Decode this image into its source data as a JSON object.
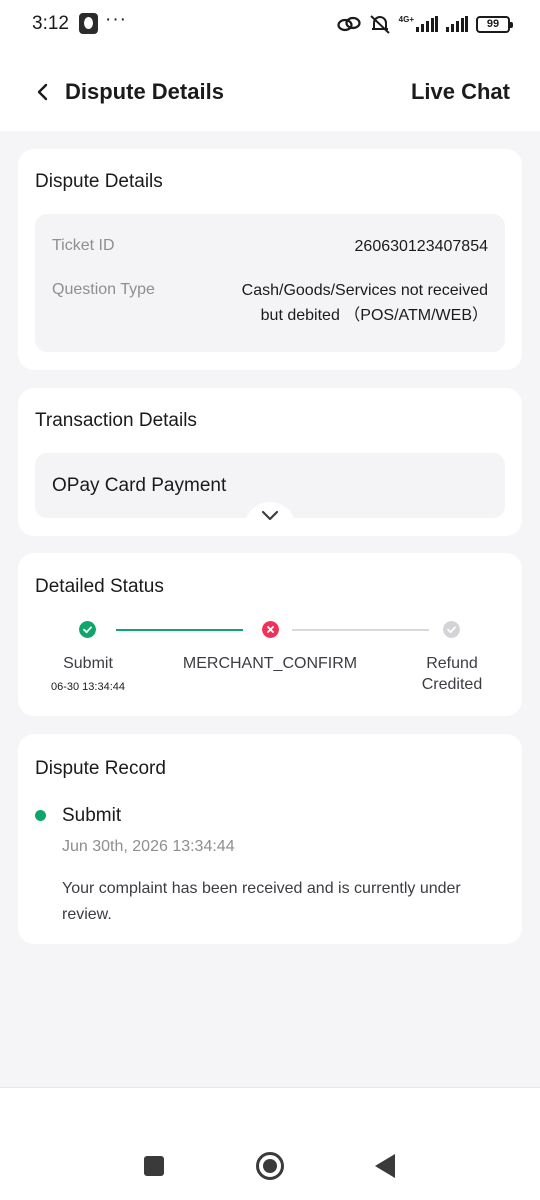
{
  "status_bar": {
    "time": "3:12",
    "dots": "···",
    "network_label": "4G+",
    "battery": "99"
  },
  "header": {
    "title": "Dispute Details",
    "live_chat_label": "Live Chat"
  },
  "dispute_details": {
    "title": "Dispute Details",
    "ticket_id_label": "Ticket ID",
    "ticket_id_value": "260630123407854",
    "question_type_label": "Question Type",
    "question_type_line1": "Cash/Goods/Services not received",
    "question_type_line2": "but debited （POS/ATM/WEB）"
  },
  "transaction_details": {
    "title": "Transaction Details",
    "payment_label": "OPay Card Payment"
  },
  "detailed_status": {
    "title": "Detailed Status",
    "steps": [
      {
        "label": "Submit",
        "time": "06-30 13:34:44",
        "state": "done"
      },
      {
        "label": "MERCHANT_CONFIRM",
        "time": "",
        "state": "failed"
      },
      {
        "label_line1": "Refund",
        "label_line2": "Credited",
        "state": "pending"
      }
    ]
  },
  "dispute_record": {
    "title": "Dispute Record",
    "entries": [
      {
        "title": "Submit",
        "time": "Jun 30th, 2026 13:34:44",
        "description": "Your complaint has been received and is currently under review."
      }
    ]
  },
  "colors": {
    "accent_green": "#0fa66c",
    "error_red": "#f0325a",
    "pending_gray": "#d4d4d8",
    "background": "#f5f5f7"
  },
  "icons": {
    "back": "chevron-left-icon",
    "expand": "chevron-down-icon",
    "step_done": "check-circle-icon",
    "step_failed": "x-circle-icon",
    "step_pending": "check-circle-gray-icon",
    "nav_recents": "square-icon",
    "nav_home": "circle-icon",
    "nav_back": "triangle-back-icon"
  }
}
